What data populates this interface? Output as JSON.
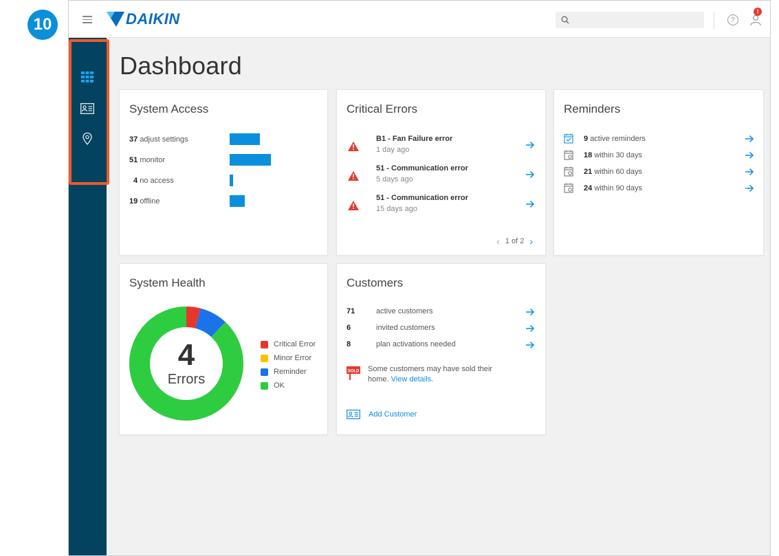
{
  "step_badge": "10",
  "brand": {
    "name": "DAIKIN",
    "color": "#0a6cbf"
  },
  "topbar": {
    "menu_icon": "hamburger-icon",
    "search_icon": "search-icon",
    "search_value": "",
    "help_icon": "help-icon",
    "help_glyph": "?",
    "user_icon": "user-icon",
    "notification_badge": "!"
  },
  "sidebar": {
    "items": [
      {
        "icon": "dashboard-grid-icon",
        "active": true
      },
      {
        "icon": "customer-card-icon",
        "active": false
      },
      {
        "icon": "location-pin-icon",
        "active": false
      }
    ],
    "highlight_color": "#ef5a28"
  },
  "page": {
    "title": "Dashboard"
  },
  "system_access": {
    "title": "System Access",
    "rows": [
      {
        "count": "37",
        "label": "adjust settings",
        "value": 37
      },
      {
        "count": "51",
        "label": "monitor",
        "value": 51
      },
      {
        "count": "4",
        "label": "no access",
        "value": 4
      },
      {
        "count": "19",
        "label": "offline",
        "value": 19
      }
    ],
    "bar_color": "#0b8fdc"
  },
  "critical_errors": {
    "title": "Critical Errors",
    "items": [
      {
        "title": "B1 - Fan Failure error",
        "time": "1 day ago"
      },
      {
        "title": "51 - Communication error",
        "time": "5 days ago"
      },
      {
        "title": "51 - Communication error",
        "time": "15 days ago"
      }
    ],
    "pager": "1 of 2",
    "prev_glyph": "‹",
    "next_glyph": "›"
  },
  "reminders": {
    "title": "Reminders",
    "items": [
      {
        "count": "9",
        "label": "active reminders"
      },
      {
        "count": "18",
        "label": "within 30 days"
      },
      {
        "count": "21",
        "label": "within 60 days"
      },
      {
        "count": "24",
        "label": "within 90 days"
      }
    ]
  },
  "system_health": {
    "title": "System Health",
    "center_value": "4",
    "center_label": "Errors",
    "legend": [
      {
        "label": "Critical Error",
        "color": "#e8362d"
      },
      {
        "label": "Minor Error",
        "color": "#f6c500"
      },
      {
        "label": "Reminder",
        "color": "#1a73e8"
      },
      {
        "label": "OK",
        "color": "#2ecc40"
      }
    ],
    "segments": [
      {
        "name": "Critical Error",
        "fraction": 0.04
      },
      {
        "name": "Minor Error",
        "fraction": 0.0
      },
      {
        "name": "Reminder",
        "fraction": 0.08
      },
      {
        "name": "OK",
        "fraction": 0.88
      }
    ]
  },
  "customers": {
    "title": "Customers",
    "rows": [
      {
        "count": "71",
        "label": "active customers"
      },
      {
        "count": "6",
        "label": "invited customers"
      },
      {
        "count": "8",
        "label": "plan activations needed"
      }
    ],
    "sold_badge": "SOLD",
    "sold_notice": "Some customers may have sold their home.",
    "sold_line1": "Some customers may have sold their",
    "sold_line2": "home.",
    "sold_link": "View details.",
    "add_customer": "Add Customer"
  }
}
